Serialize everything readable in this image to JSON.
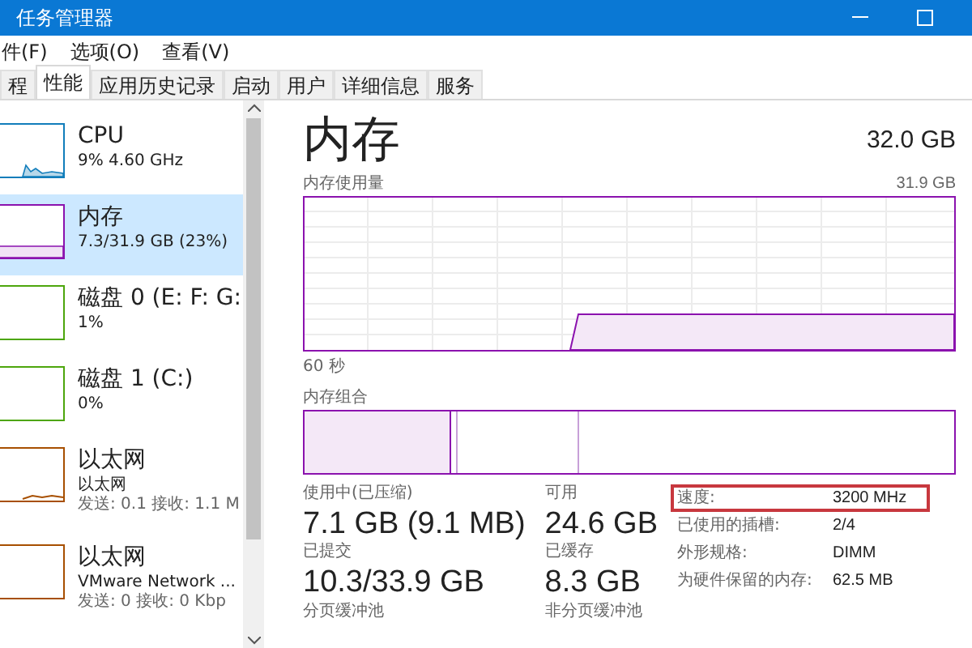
{
  "window": {
    "title": "任务管理器"
  },
  "menu": [
    "件(F)",
    "选项(O)",
    "查看(V)"
  ],
  "tabs": [
    {
      "label": "程",
      "selected": false
    },
    {
      "label": "性能",
      "selected": true
    },
    {
      "label": "应用历史记录",
      "selected": false
    },
    {
      "label": "启动",
      "selected": false
    },
    {
      "label": "用户",
      "selected": false
    },
    {
      "label": "详细信息",
      "selected": false
    },
    {
      "label": "服务",
      "selected": false
    }
  ],
  "sidebar": {
    "items": [
      {
        "name": "CPU",
        "lines": [
          "9% 4.60 GHz"
        ],
        "color": "#117dbb",
        "selected": false
      },
      {
        "name": "内存",
        "lines": [
          "7.3/31.9 GB (23%)"
        ],
        "color": "#8b12ae",
        "selected": true
      },
      {
        "name": "磁盘 0 (E: F: G:",
        "lines": [
          "1%"
        ],
        "color": "#4da60c",
        "selected": false
      },
      {
        "name": "磁盘 1 (C:)",
        "lines": [
          "0%"
        ],
        "color": "#4da60c",
        "selected": false
      },
      {
        "name": "以太网",
        "lines": [
          "以太网",
          "发送: 0.1 接收: 1.1 M"
        ],
        "color": "#a74f01",
        "selected": false
      },
      {
        "name": "以太网",
        "lines": [
          "VMware Network ...",
          "发送: 0 接收: 0 Kbp"
        ],
        "color": "#a74f01",
        "selected": false
      }
    ]
  },
  "main": {
    "title": "内存",
    "total": "32.0 GB",
    "usage_label": "内存使用量",
    "usage_max": "31.9 GB",
    "time_label": "60 秒",
    "composition_label": "内存组合",
    "stats": [
      {
        "label": "使用中(已压缩)",
        "value": "7.1 GB (9.1 MB)"
      },
      {
        "label": "可用",
        "value": "24.6 GB"
      },
      {
        "label": "已提交",
        "value": "10.3/33.9 GB"
      },
      {
        "label": "已缓存",
        "value": "8.3 GB"
      },
      {
        "label": "分页缓冲池"
      },
      {
        "label": "非分页缓冲池"
      }
    ],
    "details": [
      {
        "label": "速度:",
        "value": "3200 MHz",
        "highlighted": true
      },
      {
        "label": "已使用的插槽:",
        "value": "2/4",
        "highlighted": false
      },
      {
        "label": "外形规格:",
        "value": "DIMM",
        "highlighted": false
      },
      {
        "label": "为硬件保留的内存:",
        "value": "62.5 MB",
        "highlighted": false
      }
    ]
  }
}
